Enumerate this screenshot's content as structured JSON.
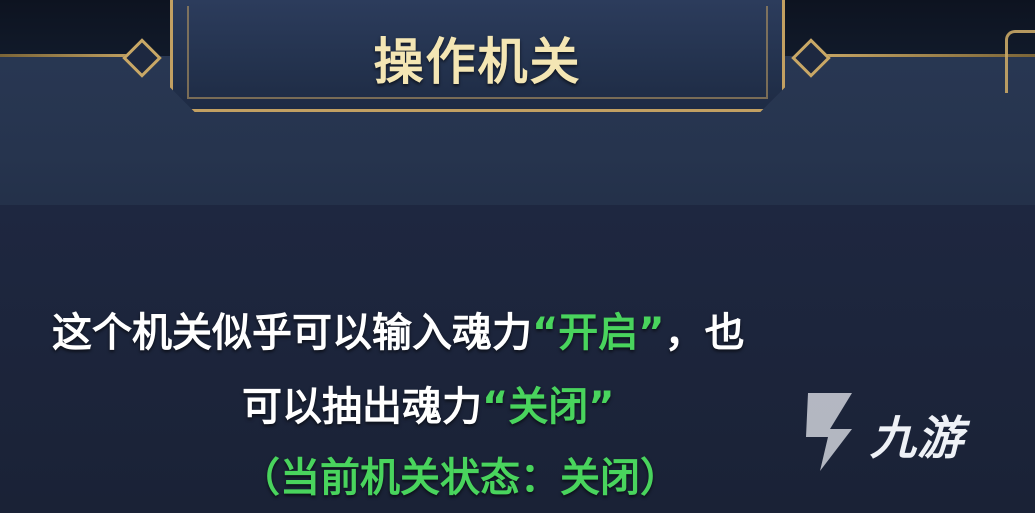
{
  "dialog": {
    "title": "操作机关",
    "line1_prefix": "这个机关似乎可以输入魂力",
    "line1_highlight": "“开启”",
    "line1_suffix": "，也",
    "line2_prefix": "可以抽出魂力",
    "line2_highlight": "“关闭”",
    "status_line": "（当前机关状态：关闭）"
  },
  "watermark": {
    "text": "九游",
    "icon": "nine-game-logo-icon"
  },
  "colors": {
    "gold_border": "#c2a062",
    "title_text": "#f4e6b4",
    "highlight_green": "#49d45d",
    "background_navy": "#26344e"
  }
}
